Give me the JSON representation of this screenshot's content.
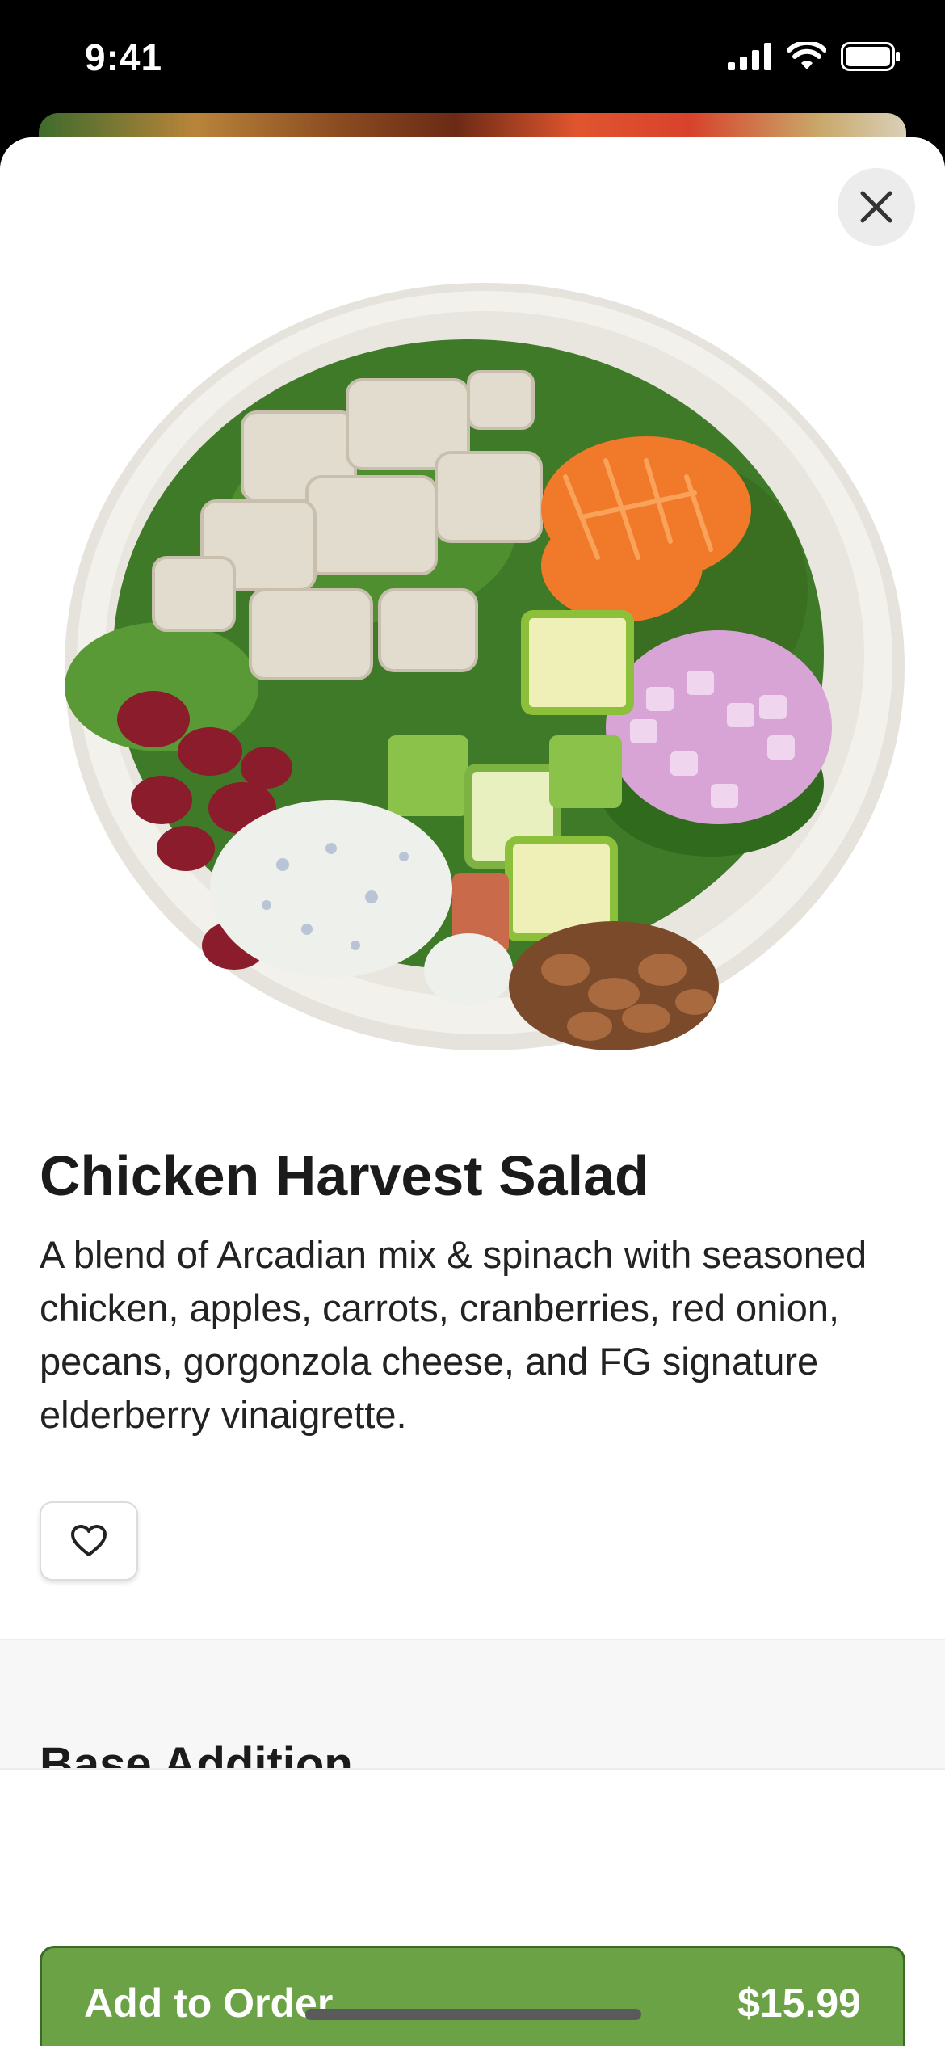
{
  "status_bar": {
    "time": "9:41"
  },
  "item": {
    "title": "Chicken Harvest Salad",
    "description": "A blend of Arcadian mix & spinach with seasoned chicken, apples, carrots, cranberries, red onion, pecans, gorgonzola cheese, and FG signature elderberry vinaigrette.",
    "image_icon": "salad-bowl-image"
  },
  "options": {
    "section_title": "Base Addition"
  },
  "footer": {
    "add_label": "Add to Order",
    "price": "$15.99"
  },
  "colors": {
    "accent": "#6aa245",
    "accent_border": "#3b6b24"
  },
  "icons": {
    "close": "close-icon",
    "favorite": "heart-icon",
    "signal": "signal-icon",
    "wifi": "wifi-icon",
    "battery": "battery-icon"
  }
}
